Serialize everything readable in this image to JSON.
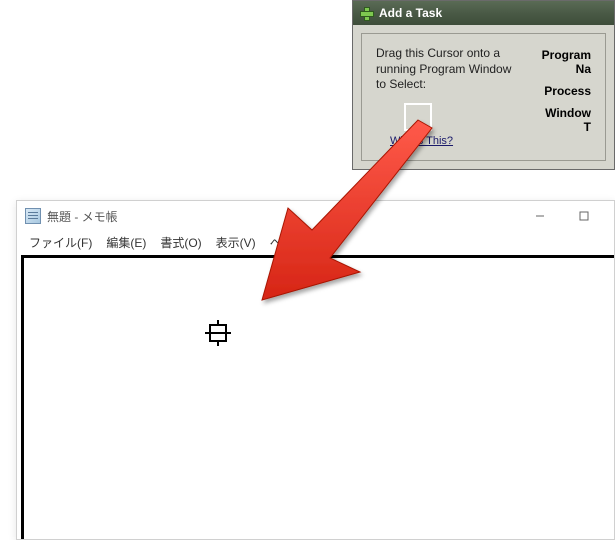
{
  "add_task": {
    "title": "Add a Task",
    "instruction": "Drag this Cursor onto a running Program Window to Select:",
    "whats_this": "What's This?",
    "labels": {
      "program_name": "Program Na",
      "process": "Process",
      "window_t": "Window T"
    }
  },
  "notepad": {
    "title": "無題 - メモ帳",
    "menu": {
      "file": "ファイル(F)",
      "edit": "編集(E)",
      "format": "書式(O)",
      "view": "表示(V)",
      "help": "ヘルプ(H)"
    }
  }
}
